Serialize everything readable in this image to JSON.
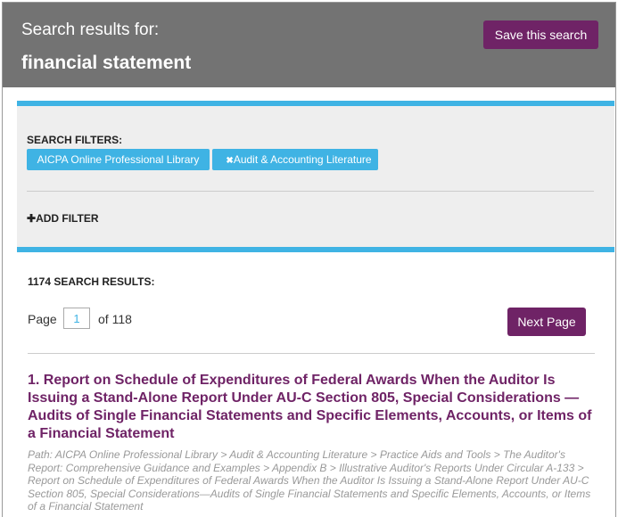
{
  "header": {
    "label": "Search results for:",
    "query": "financial statement",
    "save_label": "Save this search"
  },
  "filters": {
    "title": "SEARCH FILTERS:",
    "chips": [
      {
        "label": "AICPA Online Professional Library",
        "removable": false
      },
      {
        "label": "Audit & Accounting Literature",
        "removable": true
      }
    ],
    "remove_glyph": "✖",
    "add_glyph": "✚",
    "add_label": "ADD FILTER"
  },
  "results": {
    "count_label": "1174 SEARCH RESULTS:",
    "pager": {
      "page_label": "Page",
      "current_page": "1",
      "of_label": "of 118",
      "next_label": "Next Page"
    },
    "items": [
      {
        "title": "1. Report on Schedule of Expenditures of Federal Awards When the Auditor Is Issuing a Stand-Alone Report Under AU-C Section 805, Special Considerations —Audits of Single Financial Statements and Specific Elements, Accounts, or Items of a Financial Statement",
        "path": "Path: AICPA Online Professional Library > Audit & Accounting Literature > Practice Aids and Tools > The Auditor's Report: Comprehensive Guidance and Examples > Appendix B > Illustrative Auditor's Reports Under Circular A-133 > Report on Schedule of Expenditures of Federal Awards When the Auditor Is Issuing a Stand-Alone Report Under AU-C Section 805, Special Considerations—Audits of Single Financial Statements and Specific Elements, Accounts, or Items of a Financial Statement"
      }
    ]
  },
  "colors": {
    "header_bg": "#737373",
    "accent_purple": "#6f2366",
    "accent_blue": "#3fb3e4",
    "filters_bg": "#eeeeee"
  },
  "icons": {
    "remove": "close-icon",
    "add": "plus-icon"
  }
}
